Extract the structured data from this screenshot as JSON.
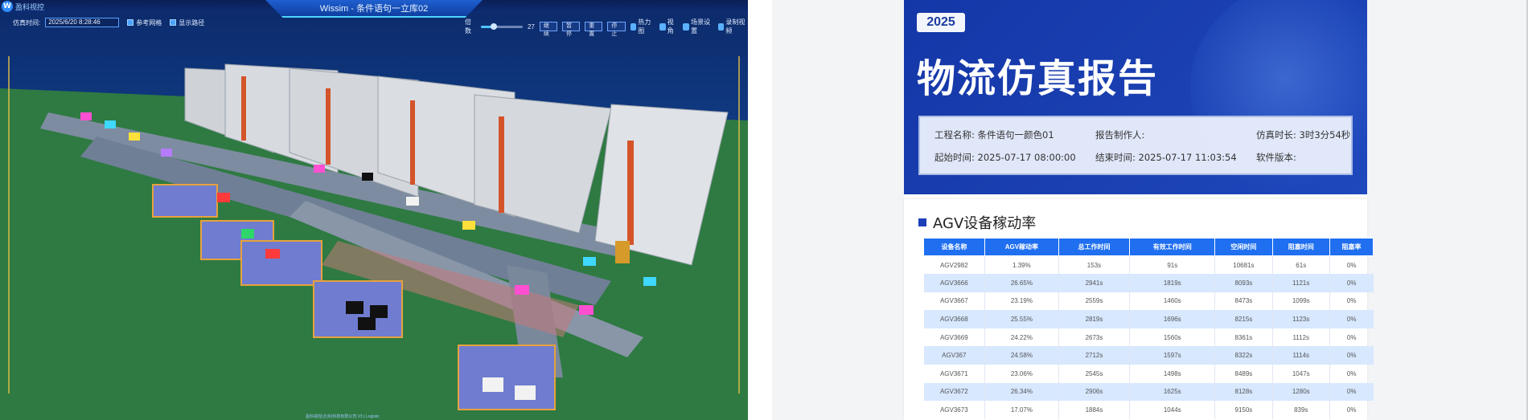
{
  "sim": {
    "logo_text": "盈科视控",
    "title": "Wissim - 条件语句一立库02",
    "time_label": "仿真时间:",
    "time_value": "2025/6/20 8:28:46",
    "checkboxes": [
      "参考网格",
      "显示路径"
    ],
    "speed_label": "倍数",
    "speed_value": "27",
    "speed_fraction": 0.3,
    "buttons": [
      "继续",
      "暂停",
      "重置",
      "停止"
    ],
    "tools": [
      "热力图",
      "视角",
      "场景设置",
      "录制视频"
    ],
    "footer": "盈科视控(北京)科技有限公司 V3 | Logistic",
    "colors": {
      "sky": "#103a82",
      "ground": "#2f7a42",
      "accent": "#4fd6ff"
    }
  },
  "report": {
    "year": "2025",
    "title": "物流仿真报告",
    "info": {
      "project_label": "工程名称:",
      "project_value": "条件语句一颜色01",
      "author_label": "报告制作人:",
      "author_value": "",
      "duration_label": "仿真时长:",
      "duration_value": "3时3分54秒",
      "start_label": "起始时间:",
      "start_value": "2025-07-17 08:00:00",
      "end_label": "结束时间:",
      "end_value": "2025-07-17 11:03:54",
      "version_label": "软件版本:",
      "version_value": ""
    },
    "section_title": "AGV设备稼动率",
    "columns": [
      "设备名称",
      "AGV稼动率",
      "总工作时间",
      "有效工作时间",
      "空闲时间",
      "阻塞时间",
      "阻塞率"
    ],
    "rows": [
      [
        "AGV2982",
        "1.39%",
        "153s",
        "91s",
        "10681s",
        "61s",
        "0%"
      ],
      [
        "AGV3666",
        "26.65%",
        "2941s",
        "1819s",
        "8093s",
        "1121s",
        "0%"
      ],
      [
        "AGV3667",
        "23.19%",
        "2559s",
        "1460s",
        "8473s",
        "1099s",
        "0%"
      ],
      [
        "AGV3668",
        "25.55%",
        "2819s",
        "1696s",
        "8215s",
        "1123s",
        "0%"
      ],
      [
        "AGV3669",
        "24.22%",
        "2673s",
        "1560s",
        "8361s",
        "1112s",
        "0%"
      ],
      [
        "AGV367",
        "24.58%",
        "2712s",
        "1597s",
        "8322s",
        "1114s",
        "0%"
      ],
      [
        "AGV3671",
        "23.06%",
        "2545s",
        "1498s",
        "8489s",
        "1047s",
        "0%"
      ],
      [
        "AGV3672",
        "26.34%",
        "2906s",
        "1625s",
        "8128s",
        "1280s",
        "0%"
      ],
      [
        "AGV3673",
        "17.07%",
        "1884s",
        "1044s",
        "9150s",
        "839s",
        "0%"
      ]
    ],
    "colors": {
      "hero": "#1a3fb0",
      "header": "#1f6ff0",
      "alt_row": "#d7e8ff"
    }
  }
}
